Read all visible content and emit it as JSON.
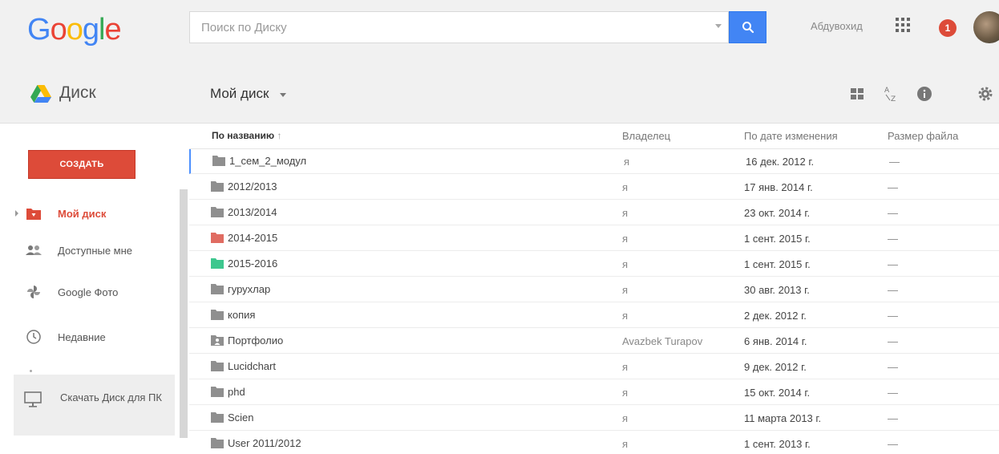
{
  "header": {
    "logo_letters": [
      "G",
      "o",
      "o",
      "g",
      "l",
      "e"
    ],
    "logo_colors": [
      "#4285f4",
      "#ea4335",
      "#fbbc05",
      "#4285f4",
      "#34a853",
      "#ea4335"
    ],
    "search_placeholder": "Поиск по Диску",
    "user_name": "Абдувохид",
    "notification_count": "1"
  },
  "subbar": {
    "app_title": "Диск",
    "folder_title": "Мой диск"
  },
  "sidebar": {
    "create_label": "СОЗДАТЬ",
    "items": [
      {
        "label": "Мой диск",
        "icon": "my-drive-icon",
        "active": true
      },
      {
        "label": "Доступные мне",
        "icon": "shared-people-icon",
        "active": false
      },
      {
        "label": "Google Фото",
        "icon": "photos-pinwheel-icon",
        "active": false
      },
      {
        "label": "Недавние",
        "icon": "clock-icon",
        "active": false
      }
    ],
    "download_label": "Скачать Диск для ПК"
  },
  "table": {
    "headers": {
      "name": "По названию",
      "owner": "Владелец",
      "modified": "По дате изменения",
      "size": "Размер файла"
    },
    "sort_arrow": "↑",
    "rows": [
      {
        "name": "1_сем_2_модул",
        "owner": "я",
        "modified": "16 дек. 2012 г.",
        "size": "—",
        "folder_color": "#8f8f8f",
        "shared": false
      },
      {
        "name": "2012/2013",
        "owner": "я",
        "modified": "17 янв. 2014 г.",
        "size": "—",
        "folder_color": "#8f8f8f",
        "shared": false
      },
      {
        "name": "2013/2014",
        "owner": "я",
        "modified": "23 окт. 2014 г.",
        "size": "—",
        "folder_color": "#8f8f8f",
        "shared": false
      },
      {
        "name": "2014-2015",
        "owner": "я",
        "modified": "1 сент. 2015 г.",
        "size": "—",
        "folder_color": "#e06c62",
        "shared": false
      },
      {
        "name": "2015-2016",
        "owner": "я",
        "modified": "1 сент. 2015 г.",
        "size": "—",
        "folder_color": "#3dc78e",
        "shared": false
      },
      {
        "name": "гурухлар",
        "owner": "я",
        "modified": "30 авг. 2013 г.",
        "size": "—",
        "folder_color": "#8f8f8f",
        "shared": false
      },
      {
        "name": "копия",
        "owner": "я",
        "modified": "2 дек. 2012 г.",
        "size": "—",
        "folder_color": "#8f8f8f",
        "shared": false
      },
      {
        "name": "Портфолио",
        "owner": "Avazbek Turapov",
        "modified": "6 янв. 2014 г.",
        "size": "—",
        "folder_color": "#8f8f8f",
        "shared": true
      },
      {
        "name": "Lucidchart",
        "owner": "я",
        "modified": "9 дек. 2012 г.",
        "size": "—",
        "folder_color": "#8f8f8f",
        "shared": false
      },
      {
        "name": "phd",
        "owner": "я",
        "modified": "15 окт. 2014 г.",
        "size": "—",
        "folder_color": "#8f8f8f",
        "shared": false
      },
      {
        "name": "Scien",
        "owner": "я",
        "modified": "11 марта 2013 г.",
        "size": "—",
        "folder_color": "#8f8f8f",
        "shared": false
      },
      {
        "name": "User 2011/2012",
        "owner": "я",
        "modified": "1 сент. 2013 г.",
        "size": "—",
        "folder_color": "#8f8f8f",
        "shared": false
      }
    ]
  },
  "colors": {
    "accent_red": "#dd4b39",
    "search_blue": "#4285f4"
  }
}
